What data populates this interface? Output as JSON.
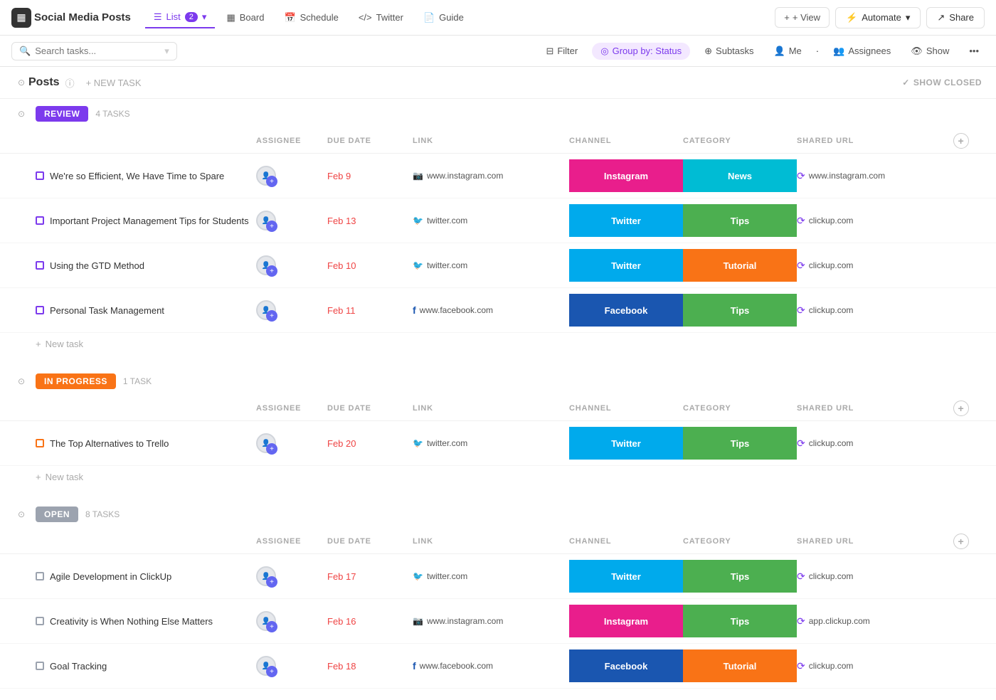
{
  "app": {
    "icon": "▦",
    "title": "Social Media Posts"
  },
  "nav": {
    "tabs": [
      {
        "id": "list",
        "label": "List",
        "badge": "2",
        "active": true,
        "icon": "☰"
      },
      {
        "id": "board",
        "label": "Board",
        "active": false,
        "icon": "▦"
      },
      {
        "id": "schedule",
        "label": "Schedule",
        "active": false,
        "icon": "📅"
      },
      {
        "id": "twitter",
        "label": "Twitter",
        "active": false,
        "icon": "<>"
      },
      {
        "id": "guide",
        "label": "Guide",
        "active": false,
        "icon": "📄"
      }
    ],
    "view_btn": "+ View",
    "automate_btn": "Automate",
    "share_btn": "Share"
  },
  "toolbar": {
    "search_placeholder": "Search tasks...",
    "filter_btn": "Filter",
    "group_btn": "Group by: Status",
    "subtasks_btn": "Subtasks",
    "me_btn": "Me",
    "assignees_btn": "Assignees",
    "show_btn": "Show",
    "more_btn": "..."
  },
  "posts_section": {
    "title": "Posts",
    "new_task": "+ NEW TASK",
    "show_closed": "SHOW CLOSED"
  },
  "columns": {
    "assignee": "ASSIGNEE",
    "due_date": "DUE DATE",
    "link": "LINK",
    "channel": "CHANNEL",
    "category": "CATEGORY",
    "shared_url": "SHARED URL"
  },
  "groups": [
    {
      "id": "review",
      "label": "REVIEW",
      "style": "review",
      "count": "4 TASKS",
      "tasks": [
        {
          "name": "We're so Efficient, We Have Time to Spare",
          "due_date": "Feb 9",
          "link_icon": "instagram",
          "link": "www.instagram.com",
          "channel": "Instagram",
          "channel_style": "instagram",
          "category": "News",
          "category_style": "news",
          "shared_icon": "clickup",
          "shared_url": "www.instagram.com",
          "checkbox_style": "purple"
        },
        {
          "name": "Important Project Management Tips for Students",
          "due_date": "Feb 13",
          "link_icon": "twitter",
          "link": "twitter.com",
          "channel": "Twitter",
          "channel_style": "twitter",
          "category": "Tips",
          "category_style": "tips",
          "shared_icon": "clickup",
          "shared_url": "clickup.com",
          "checkbox_style": "purple"
        },
        {
          "name": "Using the GTD Method",
          "due_date": "Feb 10",
          "link_icon": "twitter",
          "link": "twitter.com",
          "channel": "Twitter",
          "channel_style": "twitter",
          "category": "Tutorial",
          "category_style": "tutorial",
          "shared_icon": "clickup",
          "shared_url": "clickup.com",
          "checkbox_style": "purple"
        },
        {
          "name": "Personal Task Management",
          "due_date": "Feb 11",
          "link_icon": "facebook",
          "link": "www.facebook.com",
          "channel": "Facebook",
          "channel_style": "facebook",
          "category": "Tips",
          "category_style": "tips",
          "shared_icon": "clickup",
          "shared_url": "clickup.com",
          "checkbox_style": "purple"
        }
      ]
    },
    {
      "id": "in-progress",
      "label": "IN PROGRESS",
      "style": "in-progress",
      "count": "1 TASK",
      "tasks": [
        {
          "name": "The Top Alternatives to Trello",
          "due_date": "Feb 20",
          "link_icon": "twitter",
          "link": "twitter.com",
          "channel": "Twitter",
          "channel_style": "twitter",
          "category": "Tips",
          "category_style": "tips",
          "shared_icon": "clickup",
          "shared_url": "clickup.com",
          "checkbox_style": "orange"
        }
      ]
    },
    {
      "id": "open",
      "label": "OPEN",
      "style": "open",
      "count": "8 TASKS",
      "tasks": [
        {
          "name": "Agile Development in ClickUp",
          "due_date": "Feb 17",
          "link_icon": "twitter",
          "link": "twitter.com",
          "channel": "Twitter",
          "channel_style": "twitter",
          "category": "Tips",
          "category_style": "tips",
          "shared_icon": "clickup",
          "shared_url": "clickup.com",
          "checkbox_style": "none"
        },
        {
          "name": "Creativity is When Nothing Else Matters",
          "due_date": "Feb 16",
          "link_icon": "instagram",
          "link": "www.instagram.com",
          "channel": "Instagram",
          "channel_style": "instagram",
          "category": "Tips",
          "category_style": "tips",
          "shared_icon": "clickup",
          "shared_url": "app.clickup.com",
          "checkbox_style": "none"
        },
        {
          "name": "Goal Tracking",
          "due_date": "Feb 18",
          "link_icon": "facebook",
          "link": "www.facebook.com",
          "channel": "Facebook",
          "channel_style": "facebook",
          "category": "Tutorial",
          "category_style": "tutorial",
          "shared_icon": "clickup",
          "shared_url": "clickup.com",
          "checkbox_style": "none"
        }
      ]
    }
  ],
  "icons": {
    "instagram": "📷",
    "twitter": "🐦",
    "facebook": "f",
    "clickup": "⟳",
    "search": "🔍",
    "filter": "⊟",
    "group": "◎",
    "subtasks": "⊕",
    "me": "👤",
    "assignees": "👥",
    "show": "👁",
    "chevron_down": "▾",
    "collapse": "⊙",
    "add": "+",
    "check": "✓",
    "more": "•••"
  }
}
